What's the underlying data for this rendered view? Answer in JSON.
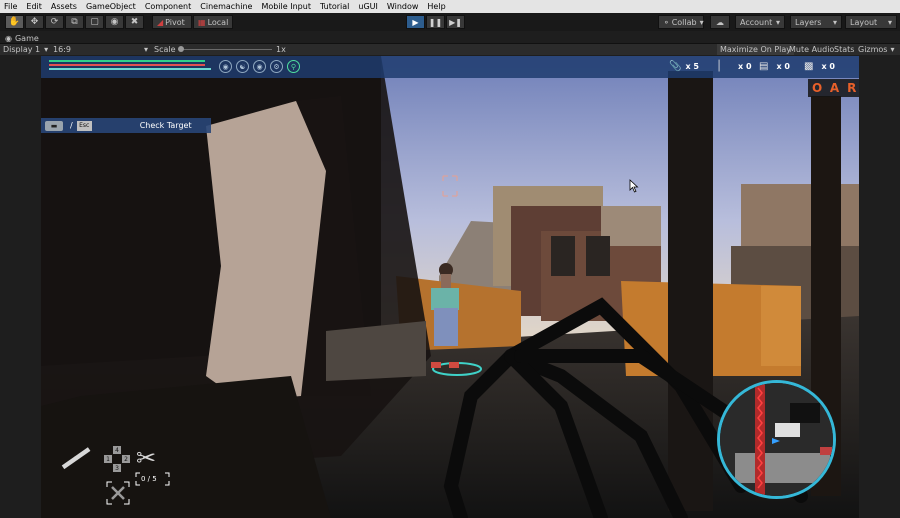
{
  "menu": {
    "items": [
      "File",
      "Edit",
      "Assets",
      "GameObject",
      "Component",
      "Cinemachine",
      "Mobile Input",
      "Tutorial",
      "uGUI",
      "Window",
      "Help"
    ]
  },
  "toolbar": {
    "pivot_label": "Pivot",
    "local_label": "Local",
    "collab_label": "Collab",
    "account_label": "Account",
    "layers_label": "Layers",
    "layout_label": "Layout"
  },
  "game_tab": {
    "label": "Game"
  },
  "game_bar": {
    "display_label": "Display 1",
    "aspect_label": "16:9",
    "scale_label": "Scale",
    "scale_value": "1x",
    "maximize_label": "Maximize On Play",
    "mute_label": "Mute Audio",
    "stats_label": "Stats",
    "gizmos_label": "Gizmos"
  },
  "hud": {
    "health_fraction": 0.96,
    "stamina_fraction": 0.96,
    "resources": [
      {
        "icon": "paperclip-icon",
        "count": "x 5"
      },
      {
        "icon": "nail-icon",
        "count": "x 0"
      },
      {
        "icon": "bricks-icon",
        "count": "x 0"
      },
      {
        "icon": "cloth-icon",
        "count": "x 0"
      }
    ],
    "objective_letters": "OAR",
    "prompt": {
      "slash": "/",
      "esc_label": "Esc",
      "text": "Check Target"
    },
    "slot_numbers": [
      "4",
      "1",
      "2",
      "3"
    ],
    "ammo_label": "0  / 5"
  },
  "colors": {
    "play_active": "#2d5d8e",
    "health": "#2fd08a",
    "stamina": "#e05050",
    "minimap_ring": "#35b8d8",
    "hud_panel": "#1e3c6e"
  }
}
